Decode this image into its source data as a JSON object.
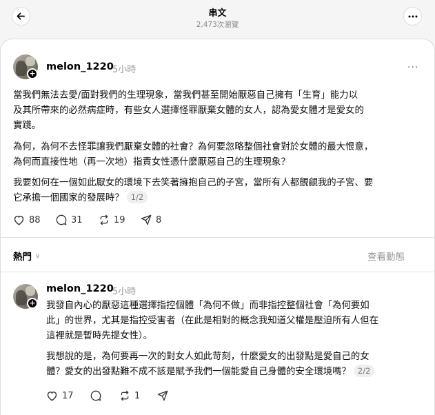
{
  "header": {
    "title": "串文",
    "views": "2,473次瀏覽"
  },
  "post1": {
    "username": "melon_1220",
    "time": "5小時",
    "para1_line1": "當我們無法去愛/面對我們的生理現象，當我們甚至開始厭惡自己擁有「生育」能力以",
    "para1_line2": "及其所帶來的必然病症時，有些女人選擇怪罪厭棄女體的女人，認為愛女體才是愛女的",
    "para1_line3": "實踐。",
    "para2_line1": "為何，為何不去怪罪讓我們厭棄女體的社會？為何要忽略整個社會對於女體的最大恨意，",
    "para2_line2": "為何而直接性地（再一次地）指責女性憑什麼厭惡自己的生理現象？",
    "para3_line1": "我要如何在一個如此厭女的環境下去笑著擁抱自己的子宮，當所有人都覬覦我的子宮、要",
    "para3_line2": "它承擔一個國家的發展時？",
    "page": "1/2",
    "likes": "88",
    "comments": "31",
    "reposts": "19",
    "shares": "8"
  },
  "sort": {
    "label": "熱門",
    "activity": "查看動態"
  },
  "post2": {
    "username": "melon_1220",
    "time": "5小時",
    "para1_line1": "我發自內心的厭惡這種選擇指控個體「為何不做」而非指控整個社會「為何要如",
    "para1_line2": "此」的世界，尤其是指控受害者（在此是相對的概念我知道父權是壓迫所有人但在",
    "para1_line3": "這裡就是暫時先提女性）。",
    "para2_line1": "我想說的是，為何要再一次的對女人如此苛刻，什麼愛女的出發點是愛自己的女",
    "para2_line2": "體？愛女的出發點難不成不該是賦予我們一個能愛自己身體的安全環境嗎？",
    "page": "2/2",
    "likes": "17",
    "reposts": "1"
  }
}
